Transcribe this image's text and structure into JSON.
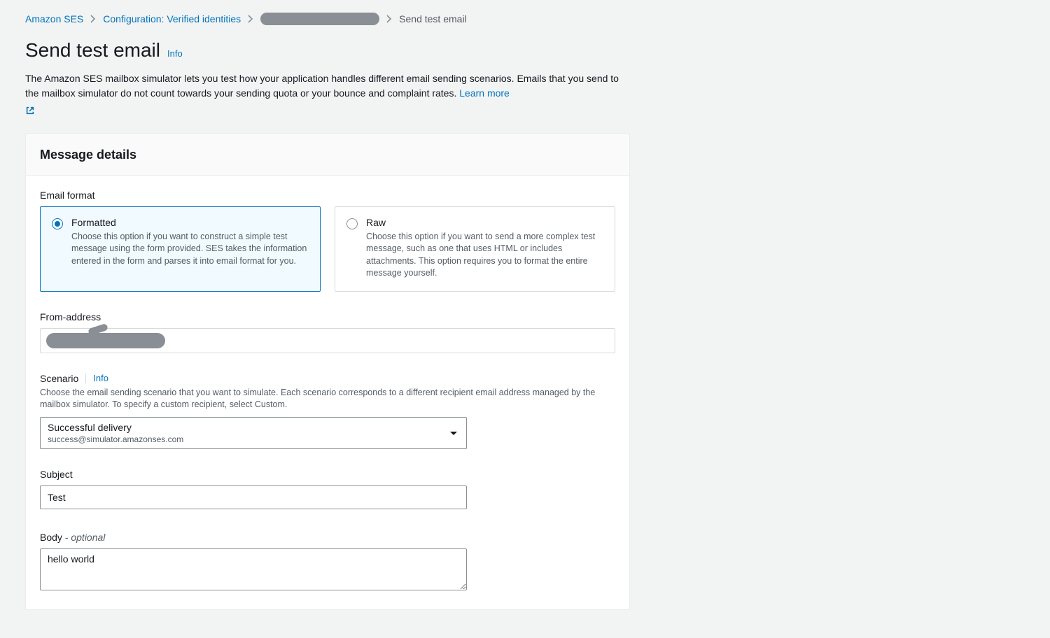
{
  "breadcrumb": {
    "items": [
      {
        "label": "Amazon SES",
        "link": true
      },
      {
        "label": "Configuration: Verified identities",
        "link": true
      },
      {
        "label": "",
        "redacted": true
      },
      {
        "label": "Send test email",
        "link": false
      }
    ]
  },
  "header": {
    "title": "Send test email",
    "info": "Info",
    "description": "The Amazon SES mailbox simulator lets you test how your application handles different email sending scenarios. Emails that you send to the mailbox simulator do not count towards your sending quota or your bounce and complaint rates. ",
    "learn_more": "Learn more"
  },
  "panel": {
    "title": "Message details",
    "email_format": {
      "label": "Email format",
      "options": [
        {
          "title": "Formatted",
          "desc": "Choose this option if you want to construct a simple test message using the form provided. SES takes the information entered in the form and parses it into email format for you.",
          "selected": true
        },
        {
          "title": "Raw",
          "desc": "Choose this option if you want to send a more complex test message, such as one that uses HTML or includes attachments. This option requires you to format the entire message yourself.",
          "selected": false
        }
      ]
    },
    "from_address": {
      "label": "From-address",
      "value": ""
    },
    "scenario": {
      "label": "Scenario",
      "info": "Info",
      "desc": "Choose the email sending scenario that you want to simulate. Each scenario corresponds to a different recipient email address managed by the mailbox simulator. To specify a custom recipient, select Custom.",
      "selected_primary": "Successful delivery",
      "selected_secondary": "success@simulator.amazonses.com"
    },
    "subject": {
      "label": "Subject",
      "value": "Test"
    },
    "body": {
      "label": "Body",
      "optional": " - optional",
      "value": "hello world"
    }
  }
}
